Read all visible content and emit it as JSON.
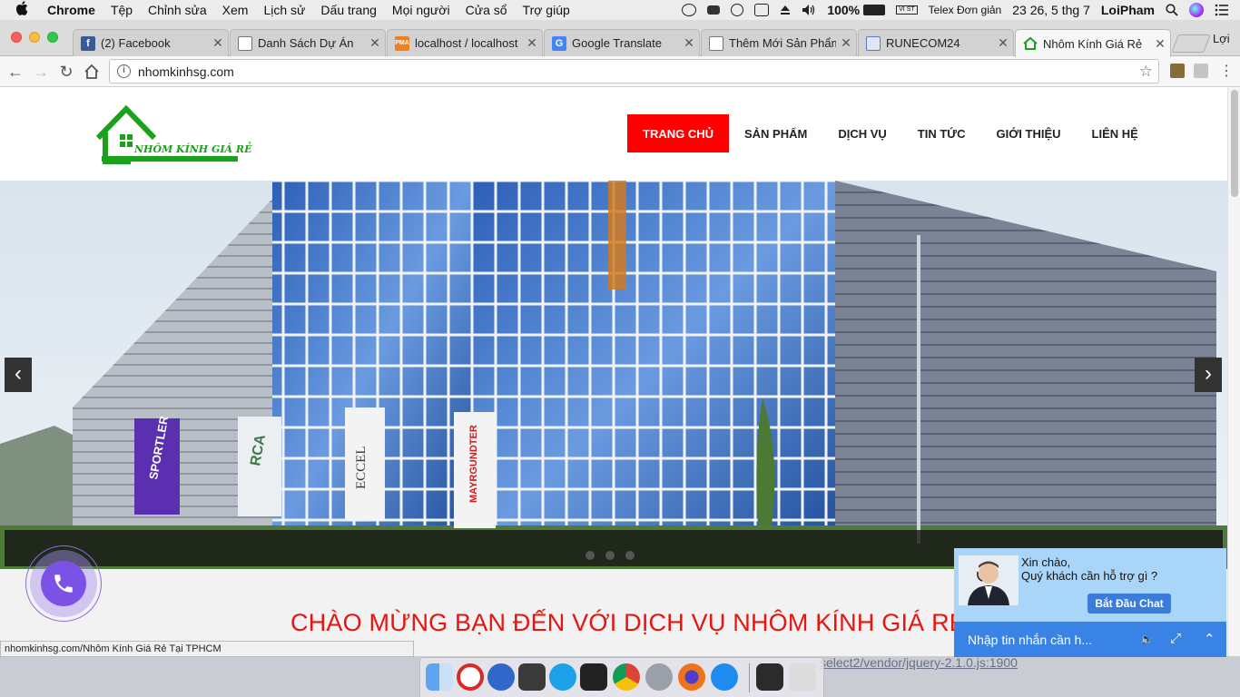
{
  "menubar": {
    "apple": "",
    "items": [
      "Chrome",
      "Tệp",
      "Chỉnh sửa",
      "Xem",
      "Lịch sử",
      "Dấu trang",
      "Mọi người",
      "Cửa sổ",
      "Trợ giúp"
    ],
    "battery": "100%",
    "input_badge": "VI ST",
    "input_method": "Telex Đơn giản",
    "clock": "23 26, 5 thg 7",
    "user": "LoiPham"
  },
  "tabs": [
    {
      "title": "(2) Facebook",
      "favicon": "facebook-icon",
      "color": "#3b5998"
    },
    {
      "title": "Danh Sách Dự Án",
      "favicon": "page-icon",
      "color": "#888888"
    },
    {
      "title": "localhost / localhost",
      "favicon": "phpmyadmin-icon",
      "color": "#f08020"
    },
    {
      "title": "Google Translate",
      "favicon": "translate-icon",
      "color": "#4285f4"
    },
    {
      "title": "Thêm Mới Sản Phẩm",
      "favicon": "page-icon",
      "color": "#888888"
    },
    {
      "title": "RUNECOM24",
      "favicon": "runecom-icon",
      "color": "#5a7bc0"
    },
    {
      "title": "Nhôm Kính Giá Rẻ",
      "favicon": "house-icon",
      "color": "#1aa31a"
    }
  ],
  "profile_label": "Lợi",
  "toolbar": {
    "url": "nhomkinhsg.com"
  },
  "site": {
    "logo_text": "NHÔM KÍNH GIÁ RẺ",
    "nav": [
      "TRANG CHỦ",
      "SẢN PHẨM",
      "DỊCH VỤ",
      "TIN TỨC",
      "GIỚI THIỆU",
      "LIÊN HỆ"
    ],
    "active_nav": 0,
    "slider": {
      "prev": "‹",
      "next": "›",
      "dots": 3
    },
    "building_signs": [
      "SPORTLER",
      "RCA",
      "ECCEL",
      "MAYRGUNDTER"
    ],
    "welcome": "CHÀO MỪNG BẠN ĐẾN VỚI DỊCH VỤ NHÔM KÍNH GIÁ RẺ"
  },
  "status_bar": "nhomkinhsg.com/Nhôm Kính Giá Rẻ Tại TPHCM",
  "chat": {
    "greeting_line1": "Xin chào,",
    "greeting_line2": "Quý khách cần hỗ trợ gì ?",
    "start_button": "Bắt Đầu Chat",
    "input_placeholder": "Nhập tin nhắn cần h..."
  },
  "background_text": "select2/vendor/jquery-2.1.0.js:1900",
  "dock_apps": [
    "finder",
    "video",
    "safari-like",
    "sublime",
    "skype",
    "terminal",
    "chrome",
    "settings",
    "firefox",
    "zalo",
    "downloads",
    "trash"
  ],
  "colors": {
    "brand_green": "#1aa31a",
    "nav_active": "#ff0000",
    "welcome_red": "#e8140f",
    "chat_blue": "#3a83e6",
    "phone_purple": "#7c52e6"
  }
}
